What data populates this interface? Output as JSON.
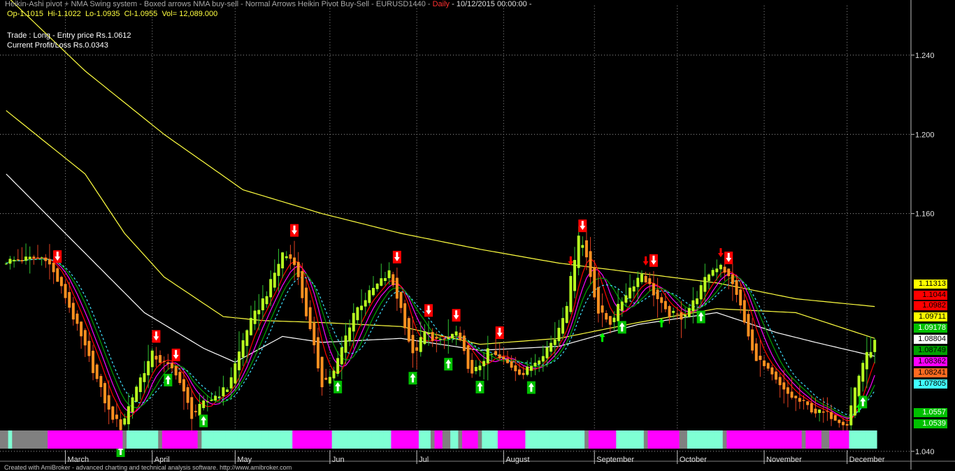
{
  "header": {
    "title_prefix": "Heikin-Ashi pivot + NMA Swing system - Boxed arrows NMA buy-sell - Normal Arrows Heikin Pivot Buy-Sell - EURUSD1440 - ",
    "interval": "Daily",
    "title_suffix": " - 10/12/2015 00:00:00 -",
    "open": "Op-1.1015",
    "high": "Hi-1.1022",
    "low": "Lo-1.0935",
    "close": "Cl-1.0955",
    "volume": "Vol= 12,089.000",
    "trade_line": "Trade : Long - Entry price Rs.1.0612",
    "profit_line": "Current Profit/Loss Rs.0.0343",
    "colors": {
      "title": "#a8a8a8",
      "interval": "#ff3030",
      "ohlc": "#ffff40"
    }
  },
  "footer": {
    "credit": "Created with AmiBroker - advanced charting and technical analysis software. http://www.amibroker.com"
  },
  "price_tags": [
    {
      "text": "1.11313",
      "bg": "#ffff00",
      "fg": "#000000"
    },
    {
      "text": "1.1044",
      "bg": "#ff0000",
      "fg": "#000000"
    },
    {
      "text": "1.0982",
      "bg": "#ff0000",
      "fg": "#000000"
    },
    {
      "text": "1.09711",
      "bg": "#ffff00",
      "fg": "#000000"
    },
    {
      "text": "1.09178",
      "bg": "#00c000",
      "fg": "#ffffff"
    },
    {
      "text": "1.08804",
      "bg": "#ffffff",
      "fg": "#000000"
    },
    {
      "text": "1.08749",
      "bg": "#00a000",
      "fg": "#000000"
    },
    {
      "text": "1.08362",
      "bg": "#ff00ff",
      "fg": "#000000"
    },
    {
      "text": "1.08241",
      "bg": "#ff6a20",
      "fg": "#000000"
    },
    {
      "text": "1.07805",
      "bg": "#40ffff",
      "fg": "#000000"
    },
    {
      "text": "1.0557",
      "bg": "#00c000",
      "fg": "#ffffff"
    },
    {
      "text": "1.0539",
      "bg": "#00c000",
      "fg": "#ffffff"
    }
  ],
  "chart_data": {
    "type": "line",
    "subtype": "heikin-ashi candlestick with moving averages",
    "title": "Heikin-Ashi pivot + NMA Swing system - EURUSD1440 - Daily - 10/12/2015 00:00:00",
    "symbol": "EURUSD1440",
    "y_axis": {
      "side": "right",
      "range": [
        1.035,
        1.265
      ],
      "ticks": [
        "1.240",
        "1.200",
        "1.160",
        "1.040"
      ],
      "grid": "dotted"
    },
    "x_axis": {
      "labels": [
        "March",
        "April",
        "May",
        "Jun",
        "Jul",
        "August",
        "September",
        "October",
        "November",
        "December"
      ],
      "grid": "dotted"
    },
    "month_index": [
      15,
      37,
      58,
      82,
      104,
      126,
      149,
      170,
      192,
      213
    ],
    "bar_count": 221,
    "price_anchors": [
      [
        0,
        1.136
      ],
      [
        10,
        1.138
      ],
      [
        15,
        1.118
      ],
      [
        20,
        1.092
      ],
      [
        26,
        1.06
      ],
      [
        29,
        1.052
      ],
      [
        33,
        1.073
      ],
      [
        37,
        1.089
      ],
      [
        40,
        1.084
      ],
      [
        43,
        1.08
      ],
      [
        47,
        1.058
      ],
      [
        50,
        1.064
      ],
      [
        56,
        1.072
      ],
      [
        61,
        1.102
      ],
      [
        66,
        1.12
      ],
      [
        70,
        1.14
      ],
      [
        73,
        1.136
      ],
      [
        75,
        1.118
      ],
      [
        80,
        1.074
      ],
      [
        83,
        1.08
      ],
      [
        88,
        1.11
      ],
      [
        93,
        1.122
      ],
      [
        97,
        1.13
      ],
      [
        100,
        1.112
      ],
      [
        103,
        1.088
      ],
      [
        106,
        1.1
      ],
      [
        110,
        1.095
      ],
      [
        114,
        1.1
      ],
      [
        118,
        1.078
      ],
      [
        122,
        1.09
      ],
      [
        128,
        1.083
      ],
      [
        131,
        1.079
      ],
      [
        136,
        1.09
      ],
      [
        139,
        1.097
      ],
      [
        142,
        1.115
      ],
      [
        145,
        1.15
      ],
      [
        147,
        1.138
      ],
      [
        150,
        1.11
      ],
      [
        153,
        1.105
      ],
      [
        157,
        1.12
      ],
      [
        161,
        1.13
      ],
      [
        164,
        1.12
      ],
      [
        167,
        1.11
      ],
      [
        171,
        1.108
      ],
      [
        174,
        1.115
      ],
      [
        178,
        1.13
      ],
      [
        181,
        1.135
      ],
      [
        185,
        1.12
      ],
      [
        189,
        1.09
      ],
      [
        193,
        1.08
      ],
      [
        197,
        1.07
      ],
      [
        201,
        1.065
      ],
      [
        205,
        1.06
      ],
      [
        209,
        1.058
      ],
      [
        213,
        1.054
      ],
      [
        215,
        1.072
      ],
      [
        217,
        1.085
      ],
      [
        220,
        1.095
      ]
    ],
    "sell_signals": [
      {
        "i": 13,
        "boxed": true
      },
      {
        "i": 38,
        "boxed": true
      },
      {
        "i": 43,
        "boxed": true
      },
      {
        "i": 73,
        "boxed": true
      },
      {
        "i": 99,
        "boxed": true
      },
      {
        "i": 107,
        "boxed": true
      },
      {
        "i": 114,
        "boxed": true
      },
      {
        "i": 125,
        "boxed": true
      },
      {
        "i": 143,
        "boxed": false
      },
      {
        "i": 146,
        "boxed": true
      },
      {
        "i": 162,
        "boxed": false
      },
      {
        "i": 164,
        "boxed": true
      },
      {
        "i": 181,
        "boxed": false
      },
      {
        "i": 183,
        "boxed": true
      }
    ],
    "buy_signals": [
      {
        "i": 29,
        "boxed": true
      },
      {
        "i": 41,
        "boxed": true
      },
      {
        "i": 50,
        "boxed": true
      },
      {
        "i": 84,
        "boxed": true
      },
      {
        "i": 103,
        "boxed": true
      },
      {
        "i": 112,
        "boxed": true
      },
      {
        "i": 120,
        "boxed": true
      },
      {
        "i": 133,
        "boxed": true
      },
      {
        "i": 151,
        "boxed": false
      },
      {
        "i": 156,
        "boxed": true
      },
      {
        "i": 166,
        "boxed": false
      },
      {
        "i": 176,
        "boxed": true
      },
      {
        "i": 216,
        "boxed": false
      },
      {
        "i": 217,
        "boxed": true
      }
    ],
    "ribbon_colors": {
      "up": "#7fffd4",
      "down": "#ff00ff",
      "flat": "#808080"
    },
    "series": [
      {
        "kind": "ma",
        "color": "#ffff40",
        "values": [
          [
            0,
            1.27
          ],
          [
            20,
            1.232
          ],
          [
            40,
            1.2
          ],
          [
            60,
            1.172
          ],
          [
            80,
            1.16
          ],
          [
            100,
            1.15
          ],
          [
            120,
            1.142
          ],
          [
            140,
            1.135
          ],
          [
            160,
            1.13
          ],
          [
            180,
            1.125
          ],
          [
            200,
            1.117
          ],
          [
            220,
            1.1131
          ]
        ]
      },
      {
        "kind": "ma",
        "color": "#ffff40",
        "values": [
          [
            0,
            1.212
          ],
          [
            20,
            1.18
          ],
          [
            30,
            1.15
          ],
          [
            40,
            1.128
          ],
          [
            55,
            1.108
          ],
          [
            65,
            1.106
          ],
          [
            80,
            1.105
          ],
          [
            100,
            1.103
          ],
          [
            120,
            1.094
          ],
          [
            140,
            1.097
          ],
          [
            160,
            1.105
          ],
          [
            180,
            1.112
          ],
          [
            200,
            1.11
          ],
          [
            220,
            1.097
          ]
        ]
      },
      {
        "kind": "ma",
        "color": "#ffffff",
        "values": [
          [
            0,
            1.18
          ],
          [
            20,
            1.14
          ],
          [
            35,
            1.11
          ],
          [
            50,
            1.092
          ],
          [
            58,
            1.085
          ],
          [
            70,
            1.098
          ],
          [
            80,
            1.095
          ],
          [
            100,
            1.097
          ],
          [
            120,
            1.091
          ],
          [
            140,
            1.093
          ],
          [
            160,
            1.104
          ],
          [
            180,
            1.11
          ],
          [
            195,
            1.1
          ],
          [
            205,
            1.095
          ],
          [
            220,
            1.088
          ]
        ]
      },
      {
        "kind": "ma",
        "color": "#ff00ff",
        "lag": 3
      },
      {
        "kind": "ma",
        "color": "#ff0000",
        "lag": 2
      },
      {
        "kind": "ma",
        "color": "#00a000",
        "lag": 4
      },
      {
        "kind": "ma",
        "color": "#40e0ff",
        "lag": 5,
        "dashed": true
      }
    ]
  }
}
